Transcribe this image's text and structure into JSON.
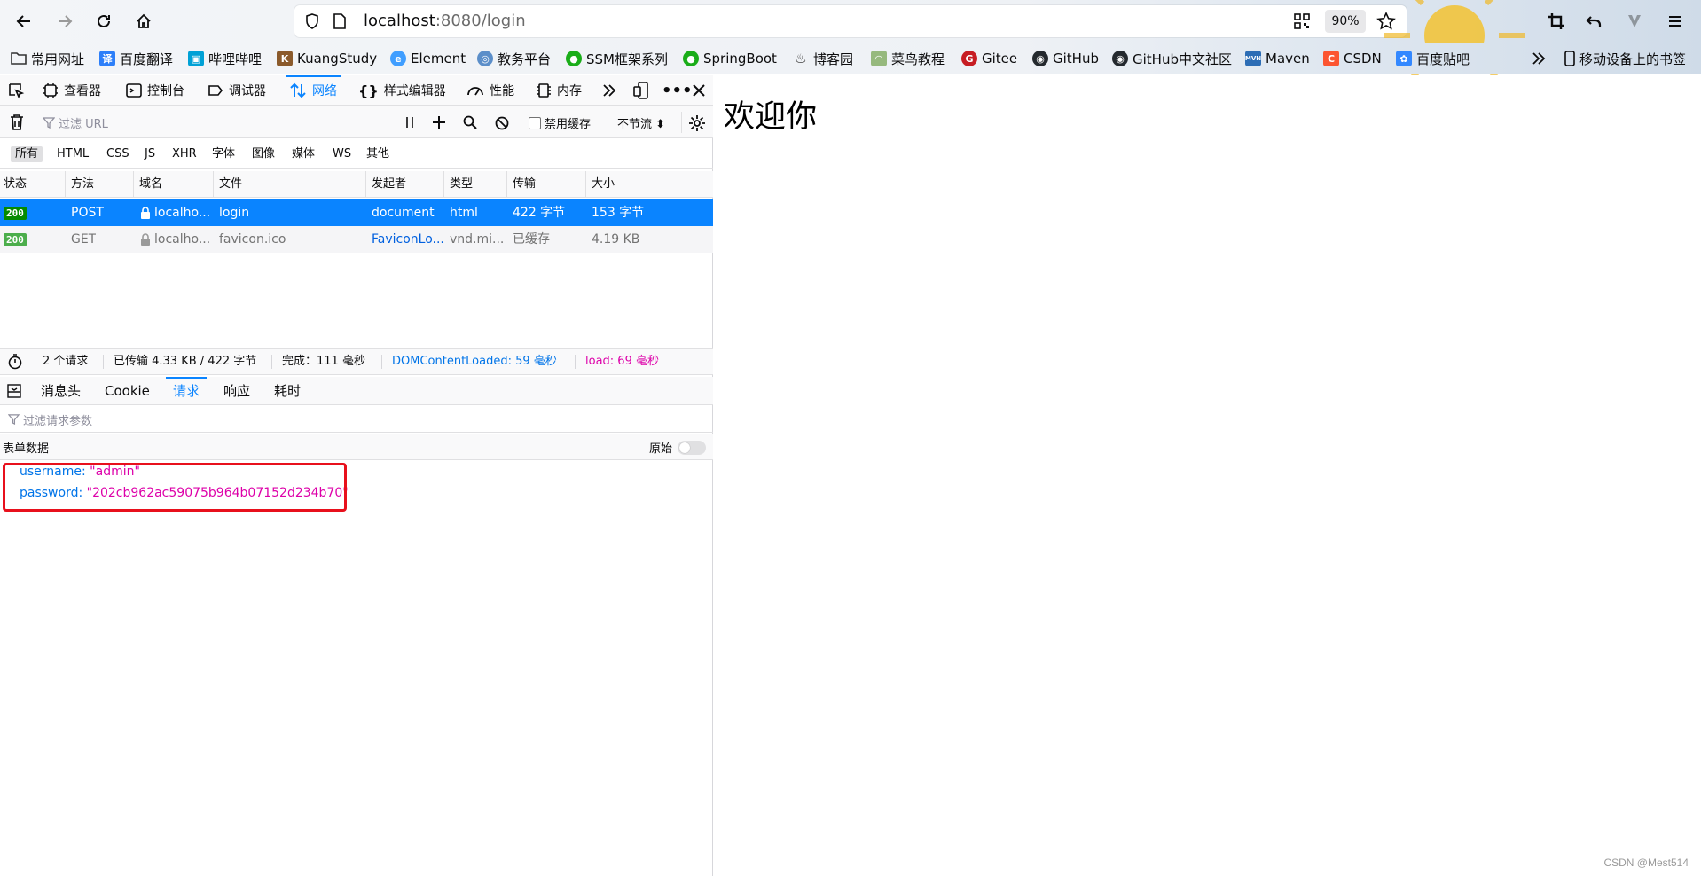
{
  "browser": {
    "url_host": "localhost",
    "url_rest": ":8080/login",
    "zoom": "90%"
  },
  "bookmarks": [
    {
      "label": "常用网址",
      "icon": "folder-icon",
      "color": "#555555"
    },
    {
      "label": "百度翻译",
      "icon": "baidu-translate-icon",
      "color": "#2d7ff9"
    },
    {
      "label": "哔哩哔哩",
      "icon": "bilibili-icon",
      "color": "#00a1d6"
    },
    {
      "label": "KuangStudy",
      "icon": "kuangstudy-icon",
      "color": "#8b5a2b"
    },
    {
      "label": "Element",
      "icon": "element-icon",
      "color": "#409eff"
    },
    {
      "label": "教务平台",
      "icon": "edu-platform-icon",
      "color": "#5b8ec9"
    },
    {
      "label": "SSM框架系列",
      "icon": "wechat-icon",
      "color": "#1aad19"
    },
    {
      "label": "SpringBoot",
      "icon": "wechat-icon",
      "color": "#1aad19"
    },
    {
      "label": "博客园",
      "icon": "cnblogs-icon",
      "color": "#333333"
    },
    {
      "label": "菜鸟教程",
      "icon": "runoob-icon",
      "color": "#96b97d"
    },
    {
      "label": "Gitee",
      "icon": "gitee-icon",
      "color": "#c71d23"
    },
    {
      "label": "GitHub",
      "icon": "github-icon",
      "color": "#24292e"
    },
    {
      "label": "GitHub中文社区",
      "icon": "github-icon",
      "color": "#24292e"
    },
    {
      "label": "Maven",
      "icon": "maven-icon",
      "color": "#2c6db5"
    },
    {
      "label": "CSDN",
      "icon": "csdn-icon",
      "color": "#fc5531"
    },
    {
      "label": "百度贴吧",
      "icon": "tieba-icon",
      "color": "#3388ff"
    }
  ],
  "bookmarks_mobile": "移动设备上的书签",
  "devtools": {
    "tabs": [
      "查看器",
      "控制台",
      "调试器",
      "网络",
      "样式编辑器",
      "性能",
      "内存"
    ],
    "active_tab": "网络",
    "filter_placeholder": "过滤 URL",
    "disable_cache": "禁用缓存",
    "throttle": "不节流 ⬍",
    "type_filters": [
      "所有",
      "HTML",
      "CSS",
      "JS",
      "XHR",
      "字体",
      "图像",
      "媒体",
      "WS",
      "其他"
    ],
    "columns": [
      "状态",
      "方法",
      "域名",
      "文件",
      "发起者",
      "类型",
      "传输",
      "大小"
    ],
    "requests": [
      {
        "status": "200",
        "method": "POST",
        "domain": "localho...",
        "file": "login",
        "initiator": "document",
        "type": "html",
        "transfer": "422 字节",
        "size": "153 字节"
      },
      {
        "status": "200",
        "method": "GET",
        "domain": "localho...",
        "file": "favicon.ico",
        "initiator": "FaviconLo...",
        "type": "vnd.mi...",
        "transfer": "已缓存",
        "size": "4.19 KB"
      }
    ],
    "summary": {
      "count": "2 个请求",
      "transferred": "已传输 4.33 KB / 422 字节",
      "finish": "完成：111 毫秒",
      "dom_loaded": "DOMContentLoaded: 59 毫秒",
      "load": "load: 69 毫秒"
    },
    "detail_tabs": [
      "消息头",
      "Cookie",
      "请求",
      "响应",
      "耗时"
    ],
    "active_detail_tab": "请求",
    "param_filter_placeholder": "过滤请求参数",
    "form_title": "表单数据",
    "raw_label": "原始",
    "form_data": [
      {
        "key": "username:",
        "value": "\"admin\""
      },
      {
        "key": "password:",
        "value": "\"202cb962ac59075b964b07152d234b70\""
      }
    ]
  },
  "page": {
    "heading": "欢迎你",
    "watermark": "CSDN @Mest514"
  },
  "colors": {
    "accent": "#0a84ff",
    "status_ok": "#058b00",
    "highlight": "#e8101c",
    "dom_loaded": "#0074e8",
    "load": "#dd00a9"
  }
}
